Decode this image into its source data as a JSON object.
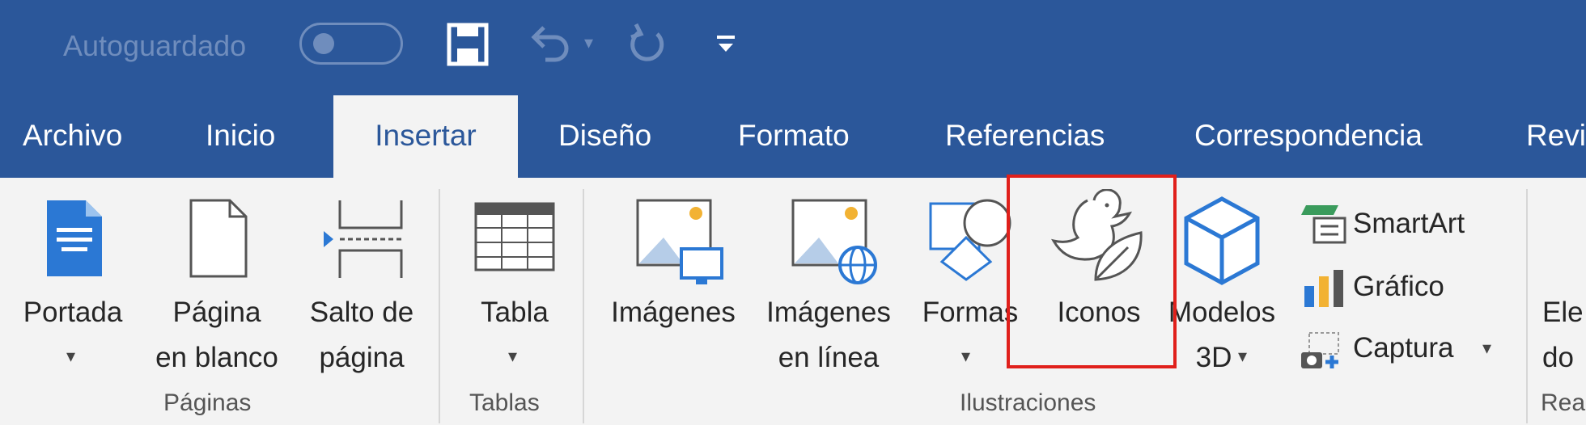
{
  "qat": {
    "autosave_label": "Autoguardado",
    "icons": [
      "save-icon",
      "undo-icon",
      "redo-icon",
      "customize-qat-icon"
    ]
  },
  "tabs": [
    {
      "label": "Archivo",
      "active": false
    },
    {
      "label": "Inicio",
      "active": false
    },
    {
      "label": "Insertar",
      "active": true
    },
    {
      "label": "Diseño",
      "active": false
    },
    {
      "label": "Formato",
      "active": false
    },
    {
      "label": "Referencias",
      "active": false
    },
    {
      "label": "Correspondencia",
      "active": false
    },
    {
      "label": "Revi",
      "active": false
    }
  ],
  "ribbon": {
    "paginas": {
      "group_label": "Páginas",
      "portada": "Portada",
      "pagina_blanco_1": "Página",
      "pagina_blanco_2": "en blanco",
      "salto_1": "Salto de",
      "salto_2": "página"
    },
    "tablas": {
      "group_label": "Tablas",
      "tabla": "Tabla"
    },
    "ilustraciones": {
      "group_label": "Ilustraciones",
      "imagenes": "Imágenes",
      "imagenes_linea_1": "Imágenes",
      "imagenes_linea_2": "en línea",
      "formas": "Formas",
      "iconos": "Iconos",
      "modelos_1": "Modelos",
      "modelos_2": "3D",
      "smartart": "SmartArt",
      "grafico": "Gráfico",
      "captura": "Captura"
    },
    "next": {
      "group_label": "Rea",
      "label_1": "Ele",
      "label_2": "do"
    }
  },
  "colors": {
    "title_bar": "#2b579a",
    "ribbon_bg": "#f3f3f3",
    "icon_blue": "#2b78d4",
    "highlight": "#e0201b"
  }
}
